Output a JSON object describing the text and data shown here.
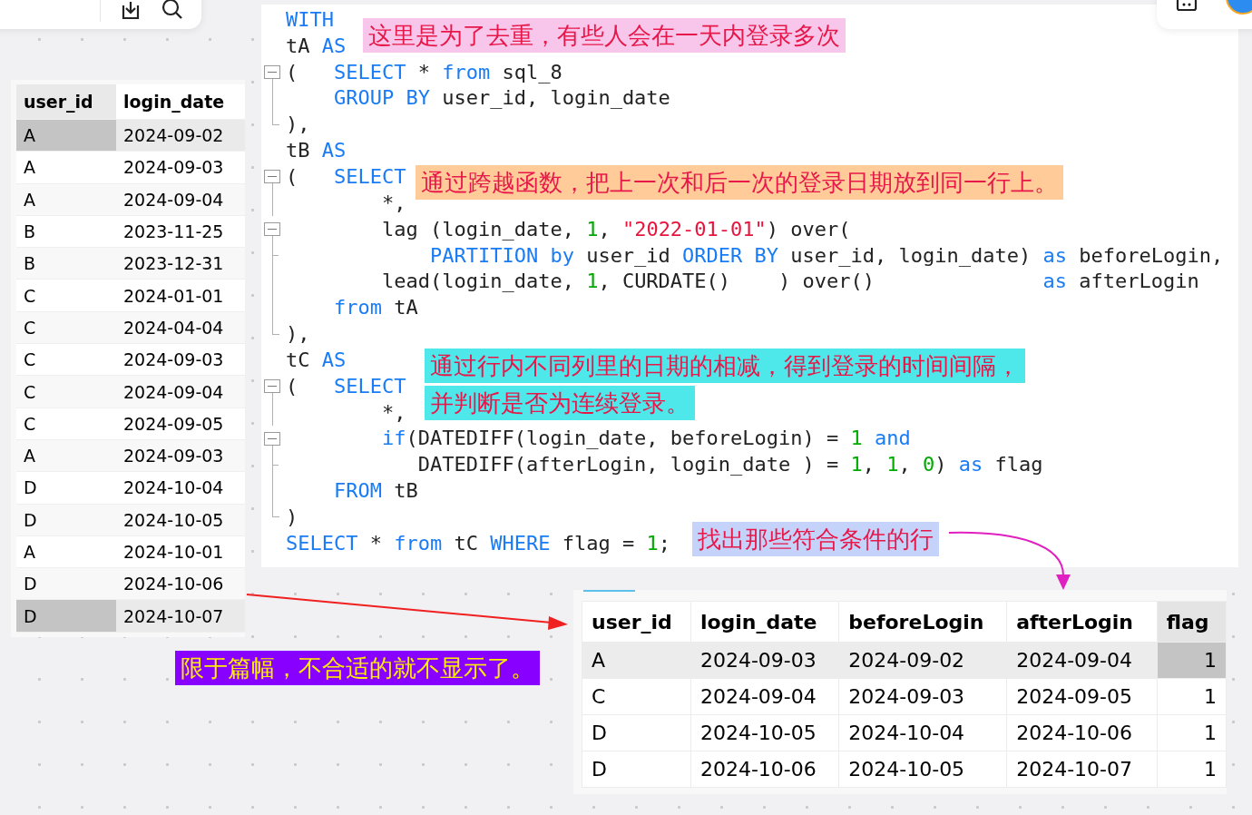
{
  "code": {
    "lines": [
      {
        "kind": "plain",
        "tokens": [
          {
            "kind": "kw",
            "t": "WITH"
          }
        ]
      },
      {
        "kind": "plain",
        "tokens": [
          {
            "kind": "p",
            "t": "tA "
          },
          {
            "kind": "kw",
            "t": "AS"
          }
        ]
      },
      {
        "kind": "fold",
        "tokens": [
          {
            "kind": "p",
            "t": "(   "
          },
          {
            "kind": "kw",
            "t": "SELECT"
          },
          {
            "kind": "p",
            "t": " * "
          },
          {
            "kind": "kw",
            "t": "from"
          },
          {
            "kind": "p",
            "t": " sql_8"
          }
        ]
      },
      {
        "kind": "inner",
        "tokens": [
          {
            "kind": "kw",
            "t": "    GROUP BY"
          },
          {
            "kind": "p",
            "t": " user_id, login_date"
          }
        ]
      },
      {
        "kind": "end",
        "tokens": [
          {
            "kind": "p",
            "t": "),"
          }
        ]
      },
      {
        "kind": "plain",
        "tokens": [
          {
            "kind": "p",
            "t": "tB "
          },
          {
            "kind": "kw",
            "t": "AS"
          }
        ]
      },
      {
        "kind": "fold",
        "tokens": [
          {
            "kind": "p",
            "t": "(   "
          },
          {
            "kind": "kw",
            "t": "SELECT"
          }
        ]
      },
      {
        "kind": "inner",
        "tokens": [
          {
            "kind": "p",
            "t": "        *,"
          }
        ]
      },
      {
        "kind": "fold",
        "tokens": [
          {
            "kind": "p",
            "t": "        lag (login_date, "
          },
          {
            "kind": "n",
            "t": "1"
          },
          {
            "kind": "p",
            "t": ", "
          },
          {
            "kind": "s",
            "t": "\"2022-01-01\""
          },
          {
            "kind": "p",
            "t": ") over("
          }
        ]
      },
      {
        "kind": "tick",
        "tokens": [
          {
            "kind": "kw",
            "t": "            PARTITION by"
          },
          {
            "kind": "p",
            "t": " user_id "
          },
          {
            "kind": "kw",
            "t": "ORDER BY"
          },
          {
            "kind": "p",
            "t": " user_id, login_date) "
          },
          {
            "kind": "kw",
            "t": "as"
          },
          {
            "kind": "p",
            "t": " beforeLogin,"
          }
        ]
      },
      {
        "kind": "inner",
        "tokens": [
          {
            "kind": "p",
            "t": "        lead(login_date, "
          },
          {
            "kind": "n",
            "t": "1"
          },
          {
            "kind": "p",
            "t": ", CURDATE()    ) over()              "
          },
          {
            "kind": "kw",
            "t": "as"
          },
          {
            "kind": "p",
            "t": " afterLogin"
          }
        ]
      },
      {
        "kind": "inner",
        "tokens": [
          {
            "kind": "kw",
            "t": "    from"
          },
          {
            "kind": "p",
            "t": " tA"
          }
        ]
      },
      {
        "kind": "end",
        "tokens": [
          {
            "kind": "p",
            "t": "),"
          }
        ]
      },
      {
        "kind": "plain",
        "tokens": [
          {
            "kind": "p",
            "t": "tC "
          },
          {
            "kind": "kw",
            "t": "AS"
          }
        ]
      },
      {
        "kind": "fold",
        "tokens": [
          {
            "kind": "p",
            "t": "(   "
          },
          {
            "kind": "kw",
            "t": "SELECT"
          }
        ]
      },
      {
        "kind": "inner",
        "tokens": [
          {
            "kind": "p",
            "t": "        *,"
          }
        ]
      },
      {
        "kind": "fold",
        "tokens": [
          {
            "kind": "kw",
            "t": "        if"
          },
          {
            "kind": "p",
            "t": "(DATEDIFF(login_date, beforeLogin) = "
          },
          {
            "kind": "n",
            "t": "1"
          },
          {
            "kind": "kw",
            "t": " and"
          }
        ]
      },
      {
        "kind": "tick",
        "tokens": [
          {
            "kind": "p",
            "t": "           DATEDIFF(afterLogin, login_date ) = "
          },
          {
            "kind": "n",
            "t": "1"
          },
          {
            "kind": "p",
            "t": ", "
          },
          {
            "kind": "n",
            "t": "1"
          },
          {
            "kind": "p",
            "t": ", "
          },
          {
            "kind": "n",
            "t": "0"
          },
          {
            "kind": "p",
            "t": ") "
          },
          {
            "kind": "kw",
            "t": "as"
          },
          {
            "kind": "p",
            "t": " flag"
          }
        ]
      },
      {
        "kind": "inner",
        "tokens": [
          {
            "kind": "kw",
            "t": "    FROM"
          },
          {
            "kind": "p",
            "t": " tB"
          }
        ]
      },
      {
        "kind": "end",
        "tokens": [
          {
            "kind": "p",
            "t": ")"
          }
        ]
      },
      {
        "kind": "plain",
        "tokens": [
          {
            "kind": "kw",
            "t": "SELECT"
          },
          {
            "kind": "p",
            "t": " * "
          },
          {
            "kind": "kw",
            "t": "from"
          },
          {
            "kind": "p",
            "t": " tC "
          },
          {
            "kind": "kw",
            "t": "WHERE"
          },
          {
            "kind": "p",
            "t": " flag = "
          },
          {
            "kind": "n",
            "t": "1"
          },
          {
            "kind": "p",
            "t": ";"
          }
        ]
      }
    ]
  },
  "annotations": [
    {
      "lines": [
        "这里是为了去重，有些人会在一天内登录多次"
      ],
      "color": "#f7c6ea"
    },
    {
      "lines": [
        "通过跨越函数，把上一次和后一次的登录日期放到同一行上。"
      ],
      "color": "#ffcc99"
    },
    {
      "lines": [
        "通过行内不同列里的日期的相减，得到登录的时间间隔，",
        "并判断是否为连续登录。"
      ],
      "color": "#4ee8ea"
    },
    {
      "lines": [
        "找出那些符合条件的行"
      ],
      "color": "#c5d3fa"
    },
    {
      "lines": [
        "限于篇幅，不合适的就不显示了。"
      ],
      "color": "#8800ff"
    }
  ],
  "source_table": {
    "columns": [
      "user_id",
      "login_date"
    ],
    "rows": [
      {
        "cells": [
          "A",
          "2024-09-02"
        ],
        "selected": true
      },
      {
        "cells": [
          "A",
          "2024-09-03"
        ],
        "selected": false
      },
      {
        "cells": [
          "A",
          "2024-09-04"
        ],
        "selected": false
      },
      {
        "cells": [
          "B",
          "2023-11-25"
        ],
        "selected": false
      },
      {
        "cells": [
          "B",
          "2023-12-31"
        ],
        "selected": false
      },
      {
        "cells": [
          "C",
          "2024-01-01"
        ],
        "selected": false
      },
      {
        "cells": [
          "C",
          "2024-04-04"
        ],
        "selected": false
      },
      {
        "cells": [
          "C",
          "2024-09-03"
        ],
        "selected": false
      },
      {
        "cells": [
          "C",
          "2024-09-04"
        ],
        "selected": false
      },
      {
        "cells": [
          "C",
          "2024-09-05"
        ],
        "selected": false
      },
      {
        "cells": [
          "A",
          "2024-09-03"
        ],
        "selected": false
      },
      {
        "cells": [
          "D",
          "2024-10-04"
        ],
        "selected": false
      },
      {
        "cells": [
          "D",
          "2024-10-05"
        ],
        "selected": false
      },
      {
        "cells": [
          "A",
          "2024-10-01"
        ],
        "selected": false
      },
      {
        "cells": [
          "D",
          "2024-10-06"
        ],
        "selected": false
      },
      {
        "cells": [
          "D",
          "2024-10-07"
        ],
        "selected": true
      }
    ]
  },
  "result_table": {
    "columns": [
      {
        "label": "user_id",
        "selected": false
      },
      {
        "label": "login_date",
        "selected": false
      },
      {
        "label": "beforeLogin",
        "selected": false
      },
      {
        "label": "afterLogin",
        "selected": false
      },
      {
        "label": "flag",
        "selected": true
      }
    ],
    "rows": [
      {
        "cells": [
          "A",
          "2024-09-03",
          "2024-09-02",
          "2024-09-04",
          "1"
        ],
        "selected": true
      },
      {
        "cells": [
          "C",
          "2024-09-04",
          "2024-09-03",
          "2024-09-05",
          "1"
        ],
        "selected": false
      },
      {
        "cells": [
          "D",
          "2024-10-05",
          "2024-10-04",
          "2024-10-06",
          "1"
        ],
        "selected": false
      },
      {
        "cells": [
          "D",
          "2024-10-06",
          "2024-10-05",
          "2024-10-07",
          "1"
        ],
        "selected": false
      }
    ]
  }
}
